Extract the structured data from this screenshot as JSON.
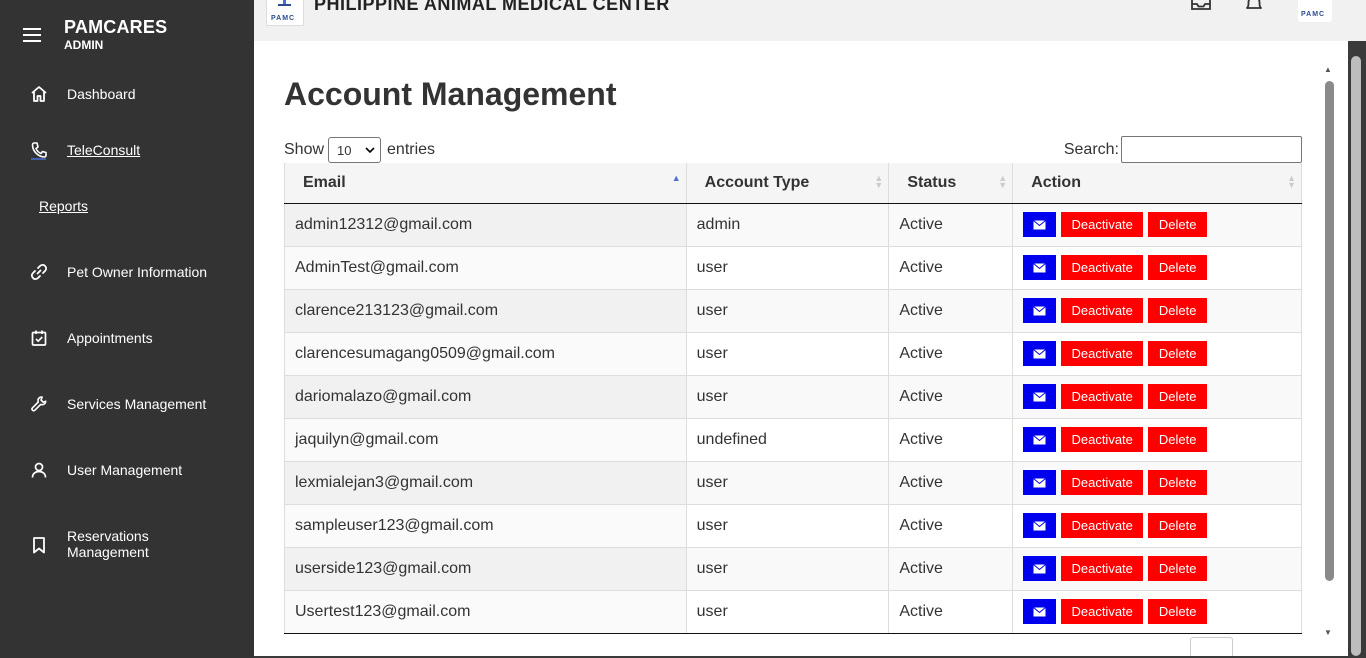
{
  "sidebar": {
    "brand_title": "PAMCARES",
    "brand_sub": "ADMIN",
    "items": [
      {
        "label": "Dashboard",
        "icon": "home-icon"
      },
      {
        "label": "TeleConsult",
        "icon": "phone-icon"
      },
      {
        "label": "Reports",
        "icon": ""
      },
      {
        "label": "Pet Owner Information",
        "icon": "link-icon"
      },
      {
        "label": "Appointments",
        "icon": "calendar-check-icon"
      },
      {
        "label": "Services Management",
        "icon": "wrench-icon"
      },
      {
        "label": "User Management",
        "icon": "user-icon"
      },
      {
        "label": "Reservations Management",
        "icon": "bookmark-icon"
      }
    ]
  },
  "topbar": {
    "site_title": "PHILIPPINE ANIMAL MEDICAL CENTER",
    "logo_text": "PAMC",
    "avatar_text": "PAMC"
  },
  "main": {
    "page_title": "Account Management",
    "show_label": "Show",
    "entries_value": "10",
    "entries_label": "entries",
    "search_label": "Search:",
    "search_value": ""
  },
  "table": {
    "columns": [
      "Email",
      "Account Type",
      "Status",
      "Action"
    ],
    "rows": [
      {
        "email": "admin12312@gmail.com",
        "type": "admin",
        "status": "Active"
      },
      {
        "email": "AdminTest@gmail.com",
        "type": "user",
        "status": "Active"
      },
      {
        "email": "clarence213123@gmail.com",
        "type": "user",
        "status": "Active"
      },
      {
        "email": "clarencesumagang0509@gmail.com",
        "type": "user",
        "status": "Active"
      },
      {
        "email": "dariomalazo@gmail.com",
        "type": "user",
        "status": "Active"
      },
      {
        "email": "jaquilyn@gmail.com",
        "type": "undefined",
        "status": "Active"
      },
      {
        "email": "lexmialejan3@gmail.com",
        "type": "user",
        "status": "Active"
      },
      {
        "email": "sampleuser123@gmail.com",
        "type": "user",
        "status": "Active"
      },
      {
        "email": "userside123@gmail.com",
        "type": "user",
        "status": "Active"
      },
      {
        "email": "Usertest123@gmail.com",
        "type": "user",
        "status": "Active"
      }
    ],
    "deactivate_label": "Deactivate",
    "delete_label": "Delete"
  },
  "colors": {
    "sidebar_bg": "#333333",
    "mail_button": "#0000ee",
    "danger_button": "#ff0000"
  }
}
